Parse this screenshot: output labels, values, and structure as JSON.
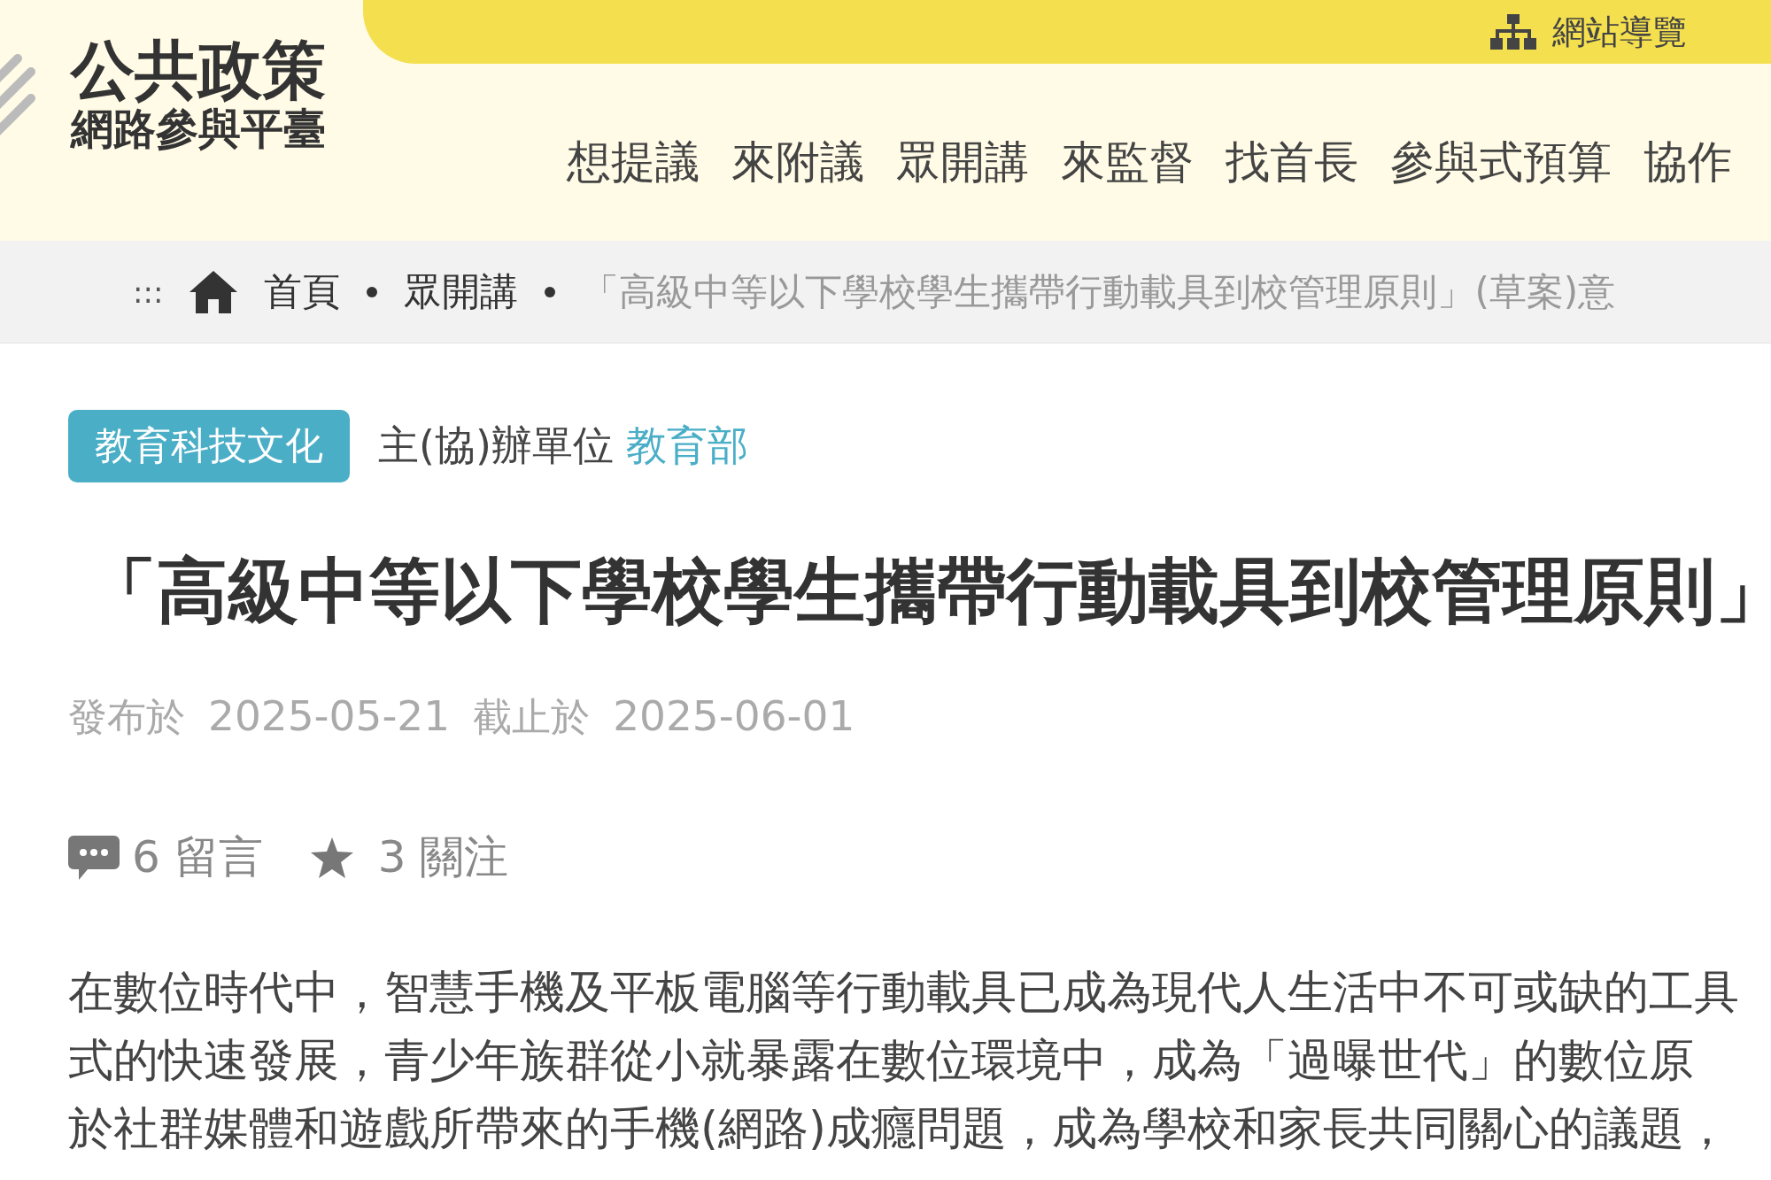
{
  "header": {
    "logo_title": "公共政策",
    "logo_subtitle": "網路參與平臺",
    "sitemap_link": "網站導覽",
    "nav": [
      {
        "label": "想提議"
      },
      {
        "label": "來附議"
      },
      {
        "label": "眾開講"
      },
      {
        "label": "來監督"
      },
      {
        "label": "找首長"
      },
      {
        "label": "參與式預算"
      },
      {
        "label": "協作"
      }
    ]
  },
  "breadcrumb": {
    "handle": ":::",
    "items": [
      {
        "label": "首頁",
        "kind": "home"
      },
      {
        "label": "眾開講",
        "kind": "link"
      },
      {
        "label": "「高級中等以下學校學生攜帶行動載具到校管理原則」(草案)意",
        "kind": "current"
      }
    ]
  },
  "article": {
    "category": "教育科技文化",
    "organizer_label": "主(協)辦單位",
    "organizer": "教育部",
    "title": "「高級中等以下學校學生攜帶行動載具到校管理原則」",
    "published_label": "發布於",
    "published": "2025-05-21",
    "deadline_label": "截止於",
    "deadline": "2025-06-01",
    "comments": "6 留言",
    "follows": "3 關注",
    "body_lines": [
      "在數位時代中，智慧手機及平板電腦等行動載具已成為現代人生活中不可或缺的工具",
      "式的快速發展，青少年族群從小就暴露在數位環境中，成為「過曝世代」的數位原",
      "於社群媒體和遊戲所帶來的手機(網路)成癮問題，成為學校和家長共同關心的議題，"
    ]
  }
}
